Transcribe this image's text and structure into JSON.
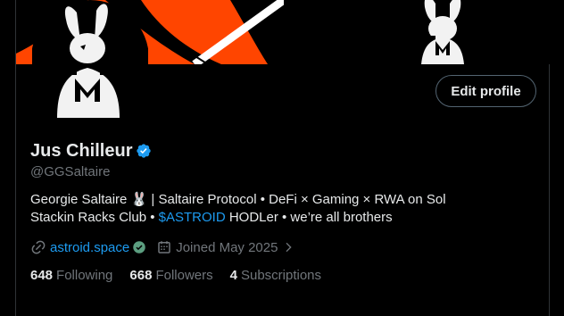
{
  "profile": {
    "name": "Jus Chilleur",
    "handle": "@GGSaltaire",
    "bio": {
      "line1": "Georgie Saltaire 🐰 | Saltaire Protocol • DeFi × Gaming × RWA on Sol",
      "line2_prefix": "Stackin Racks Club • ",
      "line2_cashtag": "$ASTROID",
      "line2_suffix": " HODLer • we’re all brothers"
    },
    "website": "astroid.space",
    "joined": "Joined May 2025"
  },
  "actions": {
    "edit_profile": "Edit profile"
  },
  "stats": {
    "following_count": "648",
    "following_label": "Following",
    "followers_count": "668",
    "followers_label": "Followers",
    "subscriptions_count": "4",
    "subscriptions_label": "Subscriptions"
  },
  "icons": {
    "verified": "verified-badge-icon",
    "link": "link-icon",
    "website_verified": "check-circle-icon",
    "calendar": "calendar-icon",
    "chevron": "chevron-right-icon"
  },
  "colors": {
    "accent": "#1d9bf0",
    "banner": "#ff4500",
    "text": "#e7e9ea",
    "muted": "#71767b",
    "badge_green": "#00ba7c"
  }
}
